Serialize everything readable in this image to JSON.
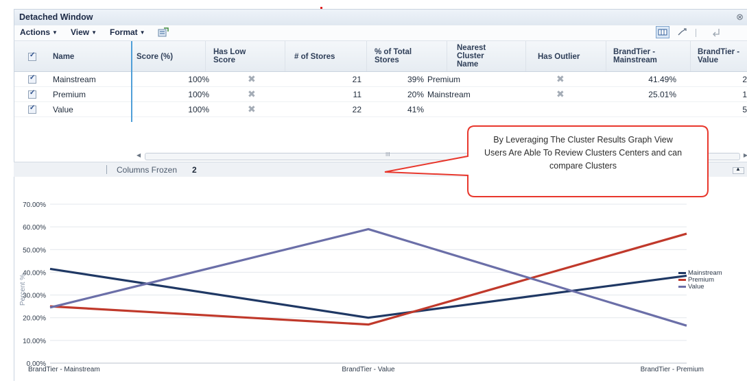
{
  "window": {
    "title": "Detached Window",
    "close_glyph": "⊗"
  },
  "toolbar": {
    "menus": [
      {
        "label": "Actions"
      },
      {
        "label": "View"
      },
      {
        "label": "Format"
      }
    ],
    "icons": [
      "export-icon",
      "grid-view-icon",
      "chart-view-icon",
      "divider-icon",
      "detach-icon"
    ]
  },
  "grid": {
    "columns": [
      "Name",
      "Score (%)",
      "Has Low Score",
      "# of Stores",
      "% of Total Stores",
      "Nearest Cluster Name",
      "Has Outlier",
      "BrandTier - Mainstream",
      "BrandTier - Value"
    ],
    "header_lines": {
      "has_low_1": "Has Low",
      "has_low_2": "Score",
      "pct_total_1": "% of Total",
      "pct_total_2": "Stores",
      "nearest_1": "Nearest",
      "nearest_2": "Cluster",
      "nearest_3": "Name",
      "bt_main_1": "BrandTier -",
      "bt_main_2": "Mainstream",
      "bt_value_1": "BrandTier -",
      "bt_value_2": "Value"
    },
    "rows": [
      {
        "name": "Mainstream",
        "score": "100%",
        "stores": "21",
        "pct": "39%",
        "nearest": "Premium",
        "bt_main": "41.49%",
        "bt_value": "2"
      },
      {
        "name": "Premium",
        "score": "100%",
        "stores": "11",
        "pct": "20%",
        "nearest": "Mainstream",
        "bt_main": "25.01%",
        "bt_value": "1"
      },
      {
        "name": "Value",
        "score": "100%",
        "stores": "22",
        "pct": "41%",
        "nearest": "",
        "bt_main": "",
        "bt_value": "5"
      }
    ],
    "scroll_thumb": "III"
  },
  "status": {
    "columns_frozen_label": "Columns Frozen",
    "columns_frozen_value": "2"
  },
  "callout": {
    "line1": "By Leveraging The Cluster Results Graph View",
    "line2": "Users Are Able To Review Clusters Centers and can",
    "line3": "compare Clusters"
  },
  "chart_data": {
    "type": "line",
    "categories": [
      "BrandTier - Mainstream",
      "BrandTier - Value",
      "BrandTier - Premium"
    ],
    "series": [
      {
        "name": "Mainstream",
        "color": "#1f3864",
        "values": [
          41.5,
          20.0,
          38.5
        ]
      },
      {
        "name": "Premium",
        "color": "#c0392b",
        "values": [
          25.0,
          17.0,
          57.0
        ]
      },
      {
        "name": "Value",
        "color": "#6b6fa8",
        "values": [
          24.5,
          59.0,
          16.5
        ]
      }
    ],
    "ylabel": "Percent %",
    "ylim": [
      0,
      70
    ],
    "yticks": [
      "0.00%",
      "10.00%",
      "20.00%",
      "30.00%",
      "40.00%",
      "50.00%",
      "60.00%",
      "70.00%"
    ],
    "grid": true,
    "legend": "right"
  }
}
